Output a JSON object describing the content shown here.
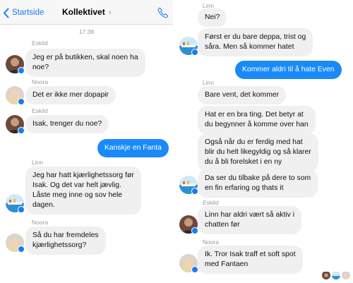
{
  "header": {
    "back_label": "Startside",
    "title": "Kollektivet",
    "title_chevron": "›"
  },
  "left": {
    "timestamp": "17.38",
    "messages": [
      {
        "sender": "Eskild",
        "text_lines": [
          "Jeg er på butikken, skal noen ha",
          "noe?"
        ]
      },
      {
        "sender": "Noora",
        "text_lines": [
          "Det er ikke mer dopapir"
        ]
      },
      {
        "sender": "Eskild",
        "text_lines": [
          "Isak, trenger du noe?"
        ]
      },
      {
        "sender": "",
        "text_lines": [
          "Kanskje en Fanta"
        ],
        "outgoing": true
      },
      {
        "sender": "Linn",
        "text_lines": [
          "Jeg har hatt kjærlighetssorg før",
          "Isak. Og det var helt jævlig.",
          "Låste meg inne og sov hele",
          "dagen."
        ]
      },
      {
        "sender": "Noora",
        "text_lines": [
          "Så du har fremdeles",
          "kjærlighetssorg?"
        ]
      }
    ]
  },
  "right": {
    "messages": [
      {
        "sender": "Linn",
        "text_lines": [
          "Nei?"
        ]
      },
      {
        "sender": "",
        "text_lines": [
          "Først er du bare deppa, trist og",
          "såra. Men så kommer hatet"
        ]
      },
      {
        "sender": "",
        "text_lines": [
          "Kommer aldri til å hate Even"
        ],
        "outgoing": true
      },
      {
        "sender": "Linn",
        "text_lines": [
          "Bare vent, det kommer"
        ]
      },
      {
        "sender": "",
        "text_lines": [
          "Hat er en bra ting. Det betyr at",
          "du begynner å komme over han"
        ]
      },
      {
        "sender": "",
        "text_lines": [
          "Også når du er ferdig med hat",
          "blir du helt likegyldig og så klarer",
          "du å bli forelsket i en ny"
        ]
      },
      {
        "sender": "",
        "text_lines": [
          "Da ser du tilbake på dere to som",
          "en fin erfaring og thats it"
        ]
      },
      {
        "sender": "Eskild",
        "text_lines": [
          "Linn har aldri vært så aktiv i",
          "chatten før"
        ]
      },
      {
        "sender": "Noora",
        "text_lines": [
          "Ik. Tror Isak traff et soft spot",
          "med Fantaen"
        ]
      }
    ]
  },
  "icons": {
    "back": "chevron-left-icon",
    "call": "phone-icon",
    "badge": "messenger-badge-icon"
  },
  "colors": {
    "accent": "#1a7cf5",
    "outgoing_bubble": "#1a8af8",
    "incoming_bubble": "#f1f0f0",
    "meta_text": "#9b9b9b"
  }
}
